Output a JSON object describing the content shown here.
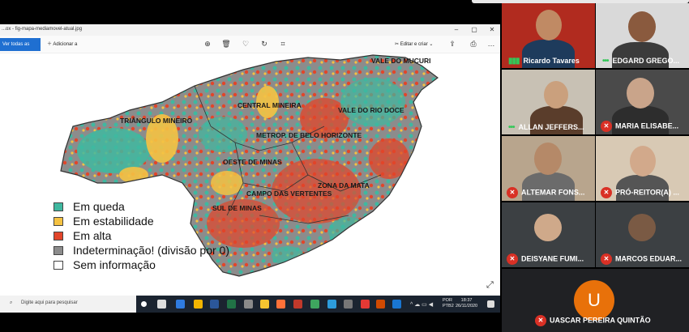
{
  "window": {
    "title": "...ox - fig-mapa-mediamovel-atual.jpg",
    "see_all_photos": "Ver todas as fotos",
    "add_to": "Adicionar a",
    "edit_create": "Editar e criar"
  },
  "map": {
    "regions": [
      "VALE DO MUCURI",
      "TRIÂNGULO MINEIRO",
      "CENTRAL MINEIRA",
      "VALE DO RIO DOCE",
      "METROP. DE BELO HORIZONTE",
      "OESTE DE MINAS",
      "ZONA DA MATA",
      "CAMPO DAS VERTENTES",
      "SUL DE MINAS"
    ],
    "colors": {
      "queda": "#3fb8a0",
      "estabilidade": "#f5c242",
      "alta": "#e2452a",
      "indeterminacao": "#8c8c8c",
      "sem_info": "#ffffff"
    },
    "legend": [
      "Em queda",
      "Em estabilidade",
      "Em alta",
      "Indeterminação! (divisão por 0)",
      "Sem informação"
    ]
  },
  "taskbar": {
    "search_placeholder": "Digite aqui para pesquisar",
    "lang": "POR",
    "kbd": "PTB2",
    "time": "18:37",
    "date": "26/11/2020"
  },
  "participants": [
    {
      "name": "Ricardo Tavares",
      "state": "speaking"
    },
    {
      "name": "EDGARD GREGO...",
      "state": "speaking"
    },
    {
      "name": "ALLAN JEFFERS...",
      "state": "speaking"
    },
    {
      "name": "MARIA ELISABE...",
      "state": "muted"
    },
    {
      "name": "ALTEMAR FONS...",
      "state": "muted"
    },
    {
      "name": "PRÓ-REITOR(A) ...",
      "state": "muted"
    },
    {
      "name": "DEISYANE FUMI...",
      "state": "muted"
    },
    {
      "name": "MARCOS EDUAR...",
      "state": "muted"
    }
  ],
  "presenter": {
    "initial": "U",
    "name": "UASCAR PEREIRA QUINTÃO"
  }
}
